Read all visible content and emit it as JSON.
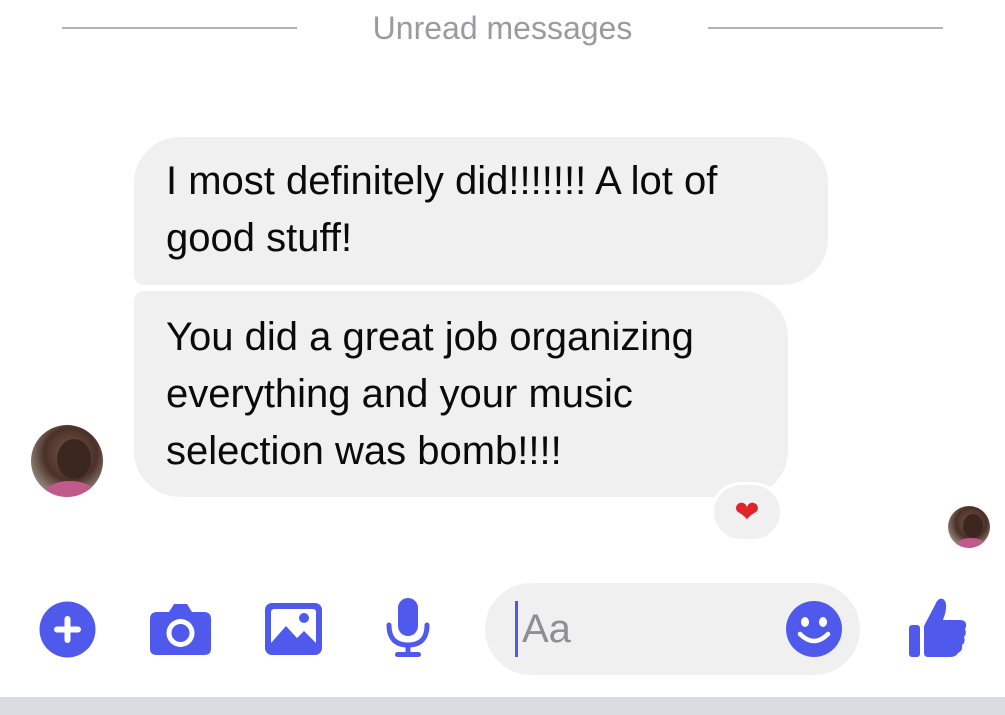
{
  "divider": {
    "label": "Unread messages"
  },
  "messages": [
    {
      "text": "I most definitely did!!!!!!! A lot of good stuff!"
    },
    {
      "text": "You did a great job organizing everything and your music selection was bomb!!!!",
      "reaction": "❤"
    }
  ],
  "composer": {
    "placeholder": "Aa"
  },
  "toolbar": {
    "icons": [
      "plus-icon",
      "camera-icon",
      "image-icon",
      "microphone-icon",
      "emoji-icon",
      "thumbs-up-icon"
    ]
  },
  "colors": {
    "accent": "#4f5aed",
    "bubble": "#f0f0f0",
    "text": "#0a0a0a",
    "muted": "#9b9b9f"
  }
}
